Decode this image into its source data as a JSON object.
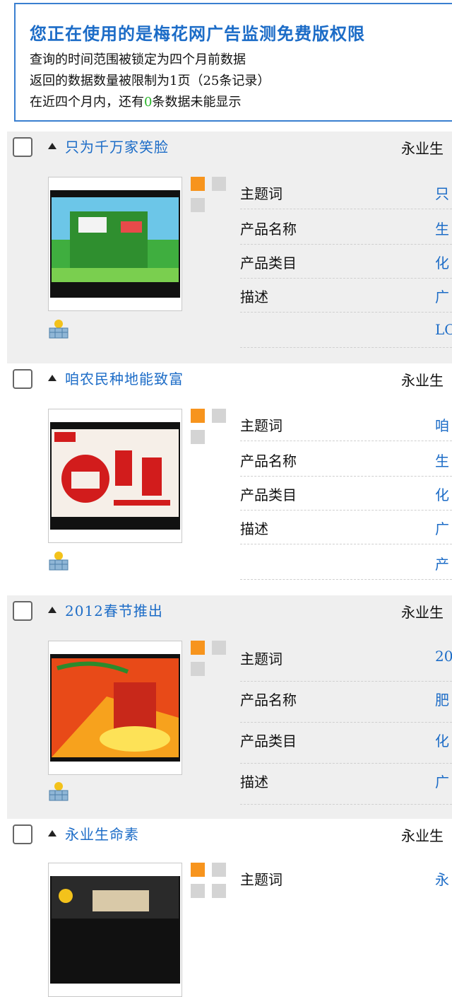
{
  "notice": {
    "title": "您正在使用的是梅花网广告监测免费版权限",
    "line1": "查询的时间范围被锁定为四个月前数据",
    "line2": "返回的数据数量被限制为1页（25条记录）",
    "line3_pre": "在近四个月内，还有",
    "line3_num": "0",
    "line3_post": "条数据未能显示"
  },
  "records": [
    {
      "title": "只为千万家笑脸",
      "brand": "永业生",
      "fields": [
        {
          "label": "主题词",
          "value": "只"
        },
        {
          "label": "产品名称",
          "value": "生"
        },
        {
          "label": "产品类目",
          "value": "化"
        },
        {
          "label": "描述",
          "value": "广"
        }
      ],
      "extra": "LO"
    },
    {
      "title": "咱农民种地能致富",
      "brand": "永业生",
      "fields": [
        {
          "label": "主题词",
          "value": "咱"
        },
        {
          "label": "产品名称",
          "value": "生"
        },
        {
          "label": "产品类目",
          "value": "化"
        },
        {
          "label": "描述",
          "value": "广"
        }
      ],
      "extra": "产"
    },
    {
      "title": "2012春节推出",
      "brand": "永业生",
      "fields": [
        {
          "label": "主题词",
          "value": "20"
        },
        {
          "label": "产品名称",
          "value": "肥"
        },
        {
          "label": "产品类目",
          "value": "化"
        },
        {
          "label": "描述",
          "value": "广"
        }
      ]
    },
    {
      "title": "永业生命素",
      "brand": "永业生",
      "fields": [
        {
          "label": "主题词",
          "value": "永"
        }
      ]
    }
  ],
  "colors": {
    "accent": "#1c6cc7",
    "orange_square": "#f7941d",
    "grey_square": "#d4d4d4",
    "highlight_number": "#2ab52a"
  },
  "icons": [
    "checkbox",
    "collapse-triangle-icon",
    "basket-icon"
  ]
}
